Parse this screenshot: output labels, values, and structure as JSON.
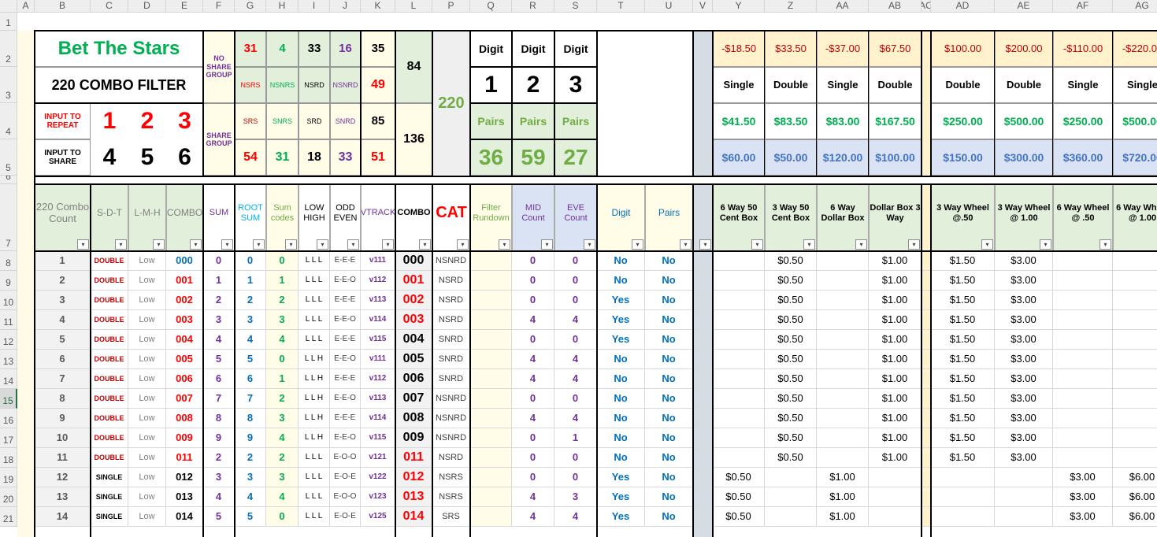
{
  "col_headers": [
    "A",
    "B",
    "C",
    "D",
    "E",
    "F",
    "G",
    "H",
    "I",
    "J",
    "K",
    "L",
    "P",
    "Q",
    "R",
    "S",
    "T",
    "U",
    "V",
    "Y",
    "Z",
    "AA",
    "AB",
    "AC",
    "AD",
    "AE",
    "AF",
    "AG"
  ],
  "row_numbers": [
    "1",
    "2",
    "3",
    "4",
    "5",
    "6",
    "7",
    "8",
    "9",
    "10",
    "11",
    "12",
    "13",
    "14",
    "15",
    "16",
    "17",
    "18",
    "19",
    "20",
    "21"
  ],
  "top": {
    "title": "Bet The Stars",
    "subtitle": "220 COMBO FILTER",
    "input_repeat_label": "INPUT TO REPEAT",
    "repeat": [
      "1",
      "2",
      "3"
    ],
    "input_share_label": "INPUT TO SHARE",
    "share": [
      "4",
      "5",
      "6"
    ],
    "no_share_group": "NO SHARE GROUP",
    "share_group": "SHARE GROUP",
    "g_vals": [
      "31",
      "4",
      "33",
      "16",
      "35"
    ],
    "g_labels": [
      "NSRS",
      "NSNRS",
      "NSRD",
      "NSNRD"
    ],
    "k3": "49",
    "l_top": "84",
    "s_labels": [
      "SRS",
      "SNRS",
      "SRD",
      "SNRD"
    ],
    "k4": "85",
    "l_bot": "136",
    "s_vals": [
      "54",
      "31",
      "18",
      "33",
      "51"
    ],
    "p_total": "220",
    "digit_label": "Digit",
    "digits": [
      "1",
      "2",
      "3"
    ],
    "pairs_label": "Pairs",
    "pairs": [
      "36",
      "59",
      "27"
    ],
    "row2": [
      "-$18.50",
      "$33.50",
      "-$37.00",
      "$67.50",
      "$100.00",
      "$200.00",
      "-$110.00",
      "-$220.00"
    ],
    "row3": [
      "Single",
      "Double",
      "Single",
      "Double",
      "Double",
      "Double",
      "Single",
      "Single"
    ],
    "row4": [
      "$41.50",
      "$83.50",
      "$83.00",
      "$167.50",
      "$250.00",
      "$500.00",
      "$250.00",
      "$500.00"
    ],
    "row5": [
      "$60.00",
      "$50.00",
      "$120.00",
      "$100.00",
      "$150.00",
      "$300.00",
      "$360.00",
      "$720.00"
    ]
  },
  "headers": [
    "220 Combo Count",
    "S-D-T",
    "L-M-H",
    "COMBO",
    "SUM",
    "ROOT SUM",
    "Sum codes",
    "LOW HIGH",
    "ODD EVEN",
    "VTRACK",
    "COMBO",
    "CAT",
    "Filter Rundown",
    "MID Count",
    "EVE Count",
    "Digit",
    "Pairs",
    "",
    "6 Way 50 Cent Box",
    "3 Way 50 Cent Box",
    "6 Way Dollar Box",
    "Dollar Box 3 Way",
    "",
    "3 Way Wheel @.50",
    "3 Way Wheel @ 1.00",
    "6 Way Wheel @ .50",
    "6 Way Wheel @ 1.00"
  ],
  "rows": [
    [
      "1",
      "DOUBLE",
      "Low",
      "000",
      "0",
      "0",
      "0",
      "L L L",
      "E-E-E",
      "v111",
      "000",
      "NSNRD",
      "",
      "0",
      "0",
      "No",
      "No",
      "",
      "",
      "$0.50",
      "",
      "$1.00",
      "",
      "$1.50",
      "$3.00",
      "",
      ""
    ],
    [
      "2",
      "DOUBLE",
      "Low",
      "001",
      "1",
      "1",
      "1",
      "L L L",
      "E-E-O",
      "v112",
      "001",
      "NSRD",
      "",
      "0",
      "0",
      "No",
      "No",
      "",
      "",
      "$0.50",
      "",
      "$1.00",
      "",
      "$1.50",
      "$3.00",
      "",
      ""
    ],
    [
      "3",
      "DOUBLE",
      "Low",
      "002",
      "2",
      "2",
      "2",
      "L L L",
      "E-E-E",
      "v113",
      "002",
      "NSRD",
      "",
      "0",
      "0",
      "Yes",
      "No",
      "",
      "",
      "$0.50",
      "",
      "$1.00",
      "",
      "$1.50",
      "$3.00",
      "",
      ""
    ],
    [
      "4",
      "DOUBLE",
      "Low",
      "003",
      "3",
      "3",
      "3",
      "L L L",
      "E-E-O",
      "v114",
      "003",
      "NSRD",
      "",
      "4",
      "4",
      "Yes",
      "No",
      "",
      "",
      "$0.50",
      "",
      "$1.00",
      "",
      "$1.50",
      "$3.00",
      "",
      ""
    ],
    [
      "5",
      "DOUBLE",
      "Low",
      "004",
      "4",
      "4",
      "4",
      "L L L",
      "E-E-E",
      "v115",
      "004",
      "SNRD",
      "",
      "0",
      "0",
      "Yes",
      "No",
      "",
      "",
      "$0.50",
      "",
      "$1.00",
      "",
      "$1.50",
      "$3.00",
      "",
      ""
    ],
    [
      "6",
      "DOUBLE",
      "Low",
      "005",
      "5",
      "5",
      "0",
      "L L H",
      "E-E-O",
      "v111",
      "005",
      "SNRD",
      "",
      "4",
      "4",
      "No",
      "No",
      "",
      "",
      "$0.50",
      "",
      "$1.00",
      "",
      "$1.50",
      "$3.00",
      "",
      ""
    ],
    [
      "7",
      "DOUBLE",
      "Low",
      "006",
      "6",
      "6",
      "1",
      "L L H",
      "E-E-E",
      "v112",
      "006",
      "SNRD",
      "",
      "4",
      "4",
      "No",
      "No",
      "",
      "",
      "$0.50",
      "",
      "$1.00",
      "",
      "$1.50",
      "$3.00",
      "",
      ""
    ],
    [
      "8",
      "DOUBLE",
      "Low",
      "007",
      "7",
      "7",
      "2",
      "L L H",
      "E-E-O",
      "v113",
      "007",
      "NSNRD",
      "",
      "0",
      "0",
      "No",
      "No",
      "",
      "",
      "$0.50",
      "",
      "$1.00",
      "",
      "$1.50",
      "$3.00",
      "",
      ""
    ],
    [
      "9",
      "DOUBLE",
      "Low",
      "008",
      "8",
      "8",
      "3",
      "L L H",
      "E-E-E",
      "v114",
      "008",
      "NSNRD",
      "",
      "4",
      "4",
      "No",
      "No",
      "",
      "",
      "$0.50",
      "",
      "$1.00",
      "",
      "$1.50",
      "$3.00",
      "",
      ""
    ],
    [
      "10",
      "DOUBLE",
      "Low",
      "009",
      "9",
      "9",
      "4",
      "L L H",
      "E-E-O",
      "v115",
      "009",
      "NSNRD",
      "",
      "0",
      "1",
      "No",
      "No",
      "",
      "",
      "$0.50",
      "",
      "$1.00",
      "",
      "$1.50",
      "$3.00",
      "",
      ""
    ],
    [
      "11",
      "DOUBLE",
      "Low",
      "011",
      "2",
      "2",
      "2",
      "L L L",
      "E-O-O",
      "v121",
      "011",
      "NSRD",
      "",
      "0",
      "0",
      "No",
      "No",
      "",
      "",
      "$0.50",
      "",
      "$1.00",
      "",
      "$1.50",
      "$3.00",
      "",
      ""
    ],
    [
      "12",
      "SINGLE",
      "Low",
      "012",
      "3",
      "3",
      "3",
      "L L L",
      "E-O-E",
      "v122",
      "012",
      "NSRS",
      "",
      "0",
      "0",
      "Yes",
      "No",
      "",
      "$0.50",
      "",
      "$1.00",
      "",
      "",
      "",
      "",
      "$3.00",
      "$6.00"
    ],
    [
      "13",
      "SINGLE",
      "Low",
      "013",
      "4",
      "4",
      "4",
      "L L L",
      "E-O-O",
      "v123",
      "013",
      "NSRS",
      "",
      "4",
      "3",
      "Yes",
      "No",
      "",
      "$0.50",
      "",
      "$1.00",
      "",
      "",
      "",
      "",
      "$3.00",
      "$6.00"
    ],
    [
      "14",
      "SINGLE",
      "Low",
      "014",
      "5",
      "5",
      "0",
      "L L L",
      "E-O-E",
      "v125",
      "014",
      "SRS",
      "",
      "4",
      "4",
      "Yes",
      "No",
      "",
      "$0.50",
      "",
      "$1.00",
      "",
      "",
      "",
      "",
      "$3.00",
      "$6.00"
    ]
  ],
  "colors": {
    "green": "#00b050",
    "red": "#ff0000",
    "purple": "#7030a0",
    "blue": "#0070c0",
    "dkred": "#c00000",
    "olive": "#70ad47"
  }
}
